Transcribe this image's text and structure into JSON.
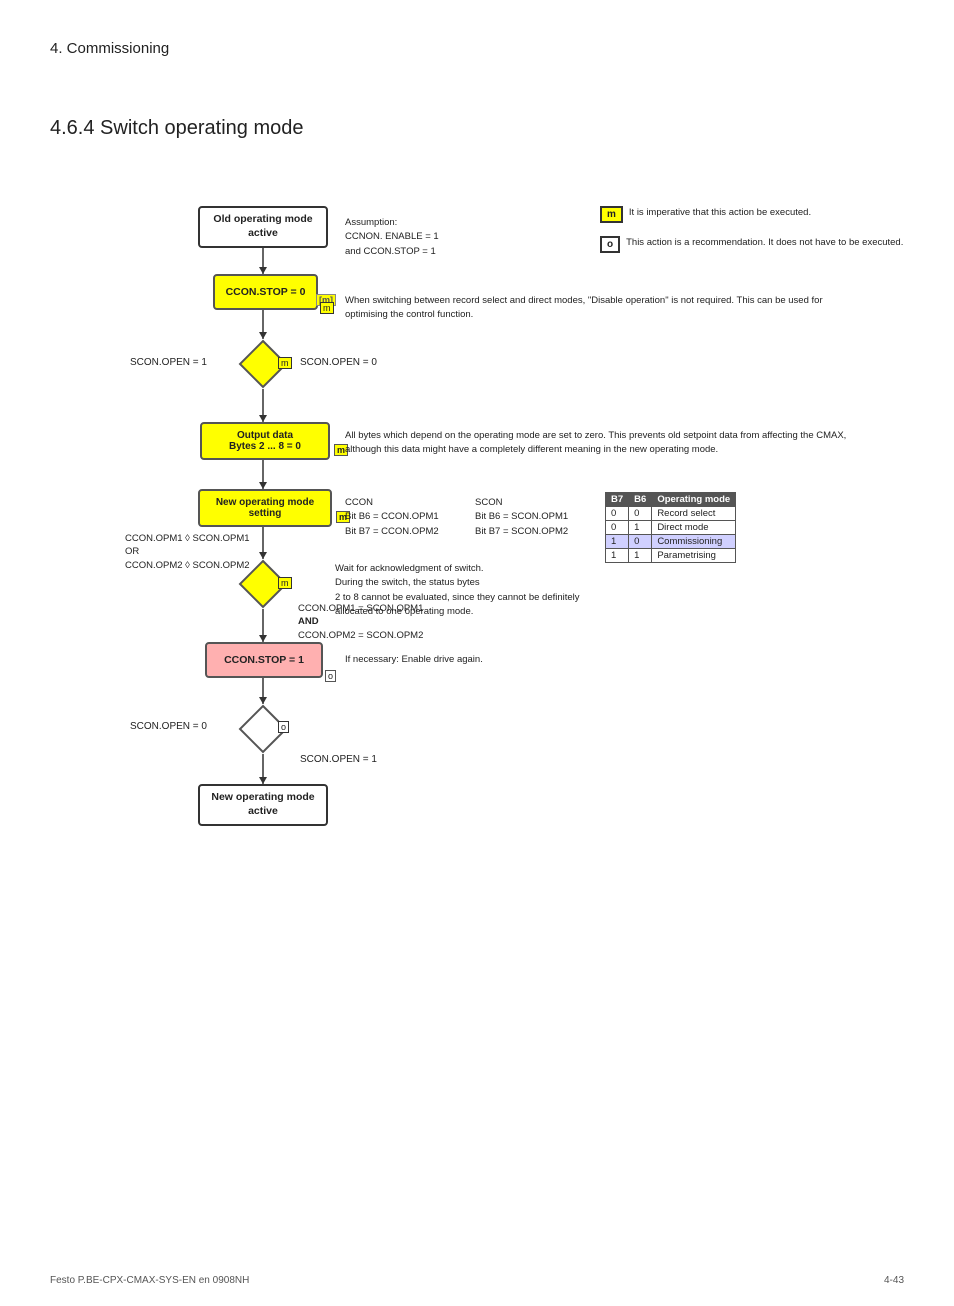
{
  "header": {
    "section": "4.   Commissioning",
    "subsection": "4.6.4   Switch operating mode"
  },
  "flowchart": {
    "box_old": "Old operating mode\nactive",
    "box_ccon_stop0": "CCON.STOP = 0",
    "box_m1": "[m]",
    "diamond1_label": "[m]",
    "scon_open1_left": "SCON.OPEN = 1",
    "scon_open0_right": "SCON.OPEN = 0",
    "box_output": "Output data\nBytes 2 ... 8 = 0",
    "box_m2": "[m]",
    "box_new_setting": "New operating mode\nsetting",
    "box_m3": "[m]",
    "ccon_opm_left": "CCON.OPM1 ◊ SCON.OPM1\nOR\nCCON.OPM2 ◊ SCON.OPM2",
    "diamond2_label": "[m]",
    "ccon_opm_right1": "CCON.OPM1 = SCON.OPM1",
    "ccon_opm_right2": "AND",
    "ccon_opm_right3": "CCON.OPM2 = SCON.OPM2",
    "box_ccon_stop1": "CCON.STOP = 1",
    "box_o1": "[o]",
    "diamond3_label": "[o]",
    "scon_open0_left2": "SCON.OPEN = 0",
    "scon_open1_right2": "SCON.OPEN = 1",
    "box_new_active": "New operating mode\nactive"
  },
  "annotations": {
    "assumption": "Assumption:\nCCNON. ENABLE = 1\nand CCON.STOP = 1",
    "legend_m_label": "m",
    "legend_m_text": "It is imperative that this action\nbe executed.",
    "legend_o_label": "o",
    "legend_o_text": "This action is a recommendation.\nIt does not have to be executed.",
    "note_switch": "When switching between record select and direct modes, \"Disable operation\" is not\nrequired. This can be used for optimising the control function.",
    "note_bytes": "All bytes which depend on the operating mode are set to zero. This prevents old\nsetpoint data from affecting the CMAX, although this data might have a completely\ndifferent meaning in the new operating mode.",
    "ccon_col": "CCON\nBit B6 = CCON.OPM1\nBit B7 = CCON.OPM2",
    "scon_col": "SCON\nBit B6 = SCON.OPM1\nBit B7 = SCON.OPM2",
    "wait_text": "Wait for acknowledgment of switch.\nDuring the switch, the status bytes\n2 to 8 cannot be evaluated, since they cannot be definitely\nallocated to one operating mode.",
    "enable_text": "If necessary: Enable drive again.",
    "table": {
      "headers": [
        "B7",
        "B6",
        "Operating mode"
      ],
      "rows": [
        [
          "0",
          "0",
          "Record select"
        ],
        [
          "0",
          "1",
          "Direct mode"
        ],
        [
          "1",
          "0",
          "Commissioning"
        ],
        [
          "1",
          "1",
          "Parametrising"
        ]
      ]
    }
  },
  "footer": {
    "left": "Festo P.BE-CPX-CMAX-SYS-EN  en 0908NH",
    "right": "4-43"
  }
}
